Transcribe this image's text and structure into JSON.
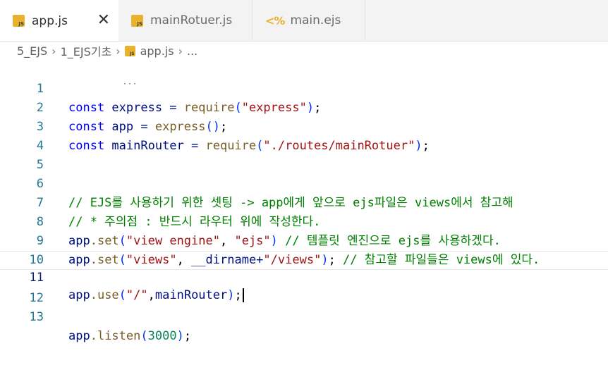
{
  "tabs": [
    {
      "label": "app.js",
      "active": true,
      "icon": "js-file-icon"
    },
    {
      "label": "mainRotuer.js",
      "active": false,
      "icon": "js-file-icon"
    },
    {
      "label": "main.ejs",
      "active": false,
      "icon": "ejs-file-icon"
    }
  ],
  "close_glyph": "✕",
  "breadcrumb": {
    "items": [
      "5_EJS",
      "1_EJS기초",
      "app.js",
      "..."
    ],
    "sep": "›"
  },
  "editor": {
    "current_line": 11,
    "lines": [
      {
        "n": "1"
      },
      {
        "n": "2"
      },
      {
        "n": "3"
      },
      {
        "n": "4"
      },
      {
        "n": "5"
      },
      {
        "n": "6"
      },
      {
        "n": "7"
      },
      {
        "n": "8"
      },
      {
        "n": "9"
      },
      {
        "n": "10"
      },
      {
        "n": "11"
      },
      {
        "n": "12"
      },
      {
        "n": "13"
      }
    ],
    "tokens": {
      "kw_const": "const",
      "l1_var": " express = ",
      "l1_fn": "require",
      "l1_str": "\"express\"",
      "l2_var": " app = ",
      "l2_fn": "express",
      "l3_var": " mainRouter = ",
      "l3_fn": "require",
      "l3_str": "\"./routes/mainRotuer\"",
      "l6": "// EJS를 사용하기 위한 셋팅 -> app에게 앞으로 ejs파일은 views에서 참고해",
      "l7": "// * 주의점 : 반드시 라우터 위에 작성한다.",
      "l8_obj": "app",
      "l8_fn": ".set",
      "l8_s1": "\"view engine\"",
      "l8_s2": "\"ejs\"",
      "l8_com": "// 템플릿 엔진으로 ejs를 사용하겠다.",
      "l9_obj": "app",
      "l9_fn": ".set",
      "l9_s1": "\"views\"",
      "l9_mid": " __dirname+",
      "l9_s2": "\"/views\"",
      "l9_com": "// 참고할 파일들은 views에 있다.",
      "l11_obj": "app",
      "l11_fn": ".use",
      "l11_s1": "\"/\"",
      "l11_arg": "mainRouter",
      "l13_obj": "app",
      "l13_fn": ".listen",
      "l13_num": "3000"
    }
  }
}
